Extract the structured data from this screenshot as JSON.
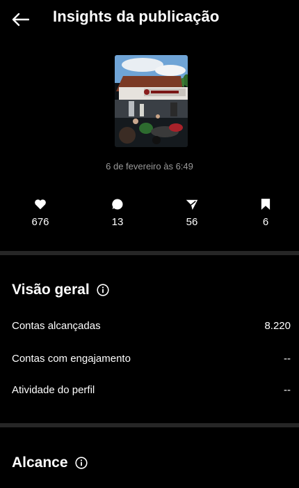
{
  "header": {
    "title": "Insights da publicação",
    "back_icon": "arrow-left-icon"
  },
  "post": {
    "date": "6 de fevereiro às 6:49"
  },
  "stats": [
    {
      "icon": "heart-icon",
      "value": "676"
    },
    {
      "icon": "comment-icon",
      "value": "13"
    },
    {
      "icon": "send-icon",
      "value": "56"
    },
    {
      "icon": "bookmark-icon",
      "value": "6"
    }
  ],
  "overview": {
    "title": "Visão geral",
    "rows": [
      {
        "label": "Contas alcançadas",
        "value": "8.220"
      },
      {
        "label": "Contas com engajamento",
        "value": "--"
      },
      {
        "label": "Atividade do perfil",
        "value": "--"
      }
    ]
  },
  "reach": {
    "title": "Alcance"
  },
  "colors": {
    "background": "#000000",
    "divider": "#262626",
    "muted_text": "#9a9a9a"
  }
}
